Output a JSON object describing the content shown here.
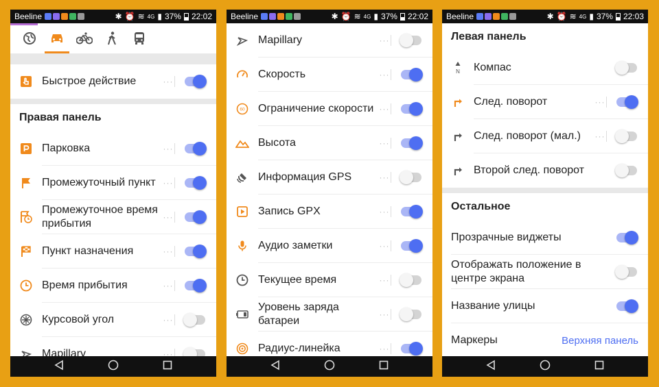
{
  "status_bars": [
    {
      "carrier": "Beeline",
      "battery": "37%",
      "network": "4G",
      "time": "22:02"
    },
    {
      "carrier": "Beeline",
      "battery": "37%",
      "network": "4G",
      "time": "22:02"
    },
    {
      "carrier": "Beeline",
      "battery": "37%",
      "network": "4G",
      "time": "22:03"
    }
  ],
  "screen1": {
    "quick_action": {
      "label": "Быстрое действие",
      "on": true
    },
    "right_panel_title": "Правая панель",
    "items": [
      {
        "label": "Парковка",
        "icon": "parking-icon",
        "on": true
      },
      {
        "label": "Промежуточный пункт",
        "icon": "flag-icon",
        "on": true
      },
      {
        "label": "Промежуточное время прибытия",
        "icon": "flag-clock-icon",
        "on": true
      },
      {
        "label": "Пункт назначения",
        "icon": "checkered-flag-icon",
        "on": true
      },
      {
        "label": "Время прибытия",
        "icon": "clock-icon",
        "on": true
      },
      {
        "label": "Курсовой угол",
        "icon": "bearing-icon",
        "on": false
      },
      {
        "label": "Mapillary",
        "icon": "mapillary-icon",
        "on": false
      }
    ]
  },
  "screen2": {
    "items": [
      {
        "label": "Mapillary",
        "icon": "mapillary-icon",
        "on": false
      },
      {
        "label": "Скорость",
        "icon": "speedometer-icon",
        "on": true
      },
      {
        "label": "Ограничение скорости",
        "icon": "speed-limit-icon",
        "on": true
      },
      {
        "label": "Высота",
        "icon": "mountain-icon",
        "on": true
      },
      {
        "label": "Информация GPS",
        "icon": "satellite-icon",
        "on": false
      },
      {
        "label": "Запись GPX",
        "icon": "record-icon",
        "on": true
      },
      {
        "label": "Аудио заметки",
        "icon": "microphone-icon",
        "on": true
      },
      {
        "label": "Текущее время",
        "icon": "clock-icon",
        "on": false
      },
      {
        "label": "Уровень заряда батареи",
        "icon": "battery-icon",
        "on": false
      },
      {
        "label": "Радиус-линейка",
        "icon": "ruler-radius-icon",
        "on": true
      }
    ]
  },
  "screen3": {
    "left_panel_title": "Левая панель",
    "left_items": [
      {
        "label": "Компас",
        "icon": "compass-icon",
        "on": false,
        "dots": false
      },
      {
        "label": "След. поворот",
        "icon": "turn-right-icon",
        "on": true,
        "dots": true
      },
      {
        "label": "След. поворот (мал.)",
        "icon": "turn-right-small-icon",
        "on": false,
        "dots": true
      },
      {
        "label": "Второй след. поворот",
        "icon": "second-turn-icon",
        "on": false,
        "dots": false
      }
    ],
    "other_title": "Остальное",
    "other_items": [
      {
        "label": "Прозрачные виджеты",
        "on": true
      },
      {
        "label": "Отображать положение в центре экрана",
        "on": false
      },
      {
        "label": "Название улицы",
        "on": true
      }
    ],
    "markers": {
      "label": "Маркеры",
      "value": "Верхняя панель"
    }
  },
  "colors": {
    "background": "#e8a014",
    "accent_orange": "#f08a1c",
    "toggle_on": "#4e6ef2",
    "link": "#4e6ef2"
  }
}
